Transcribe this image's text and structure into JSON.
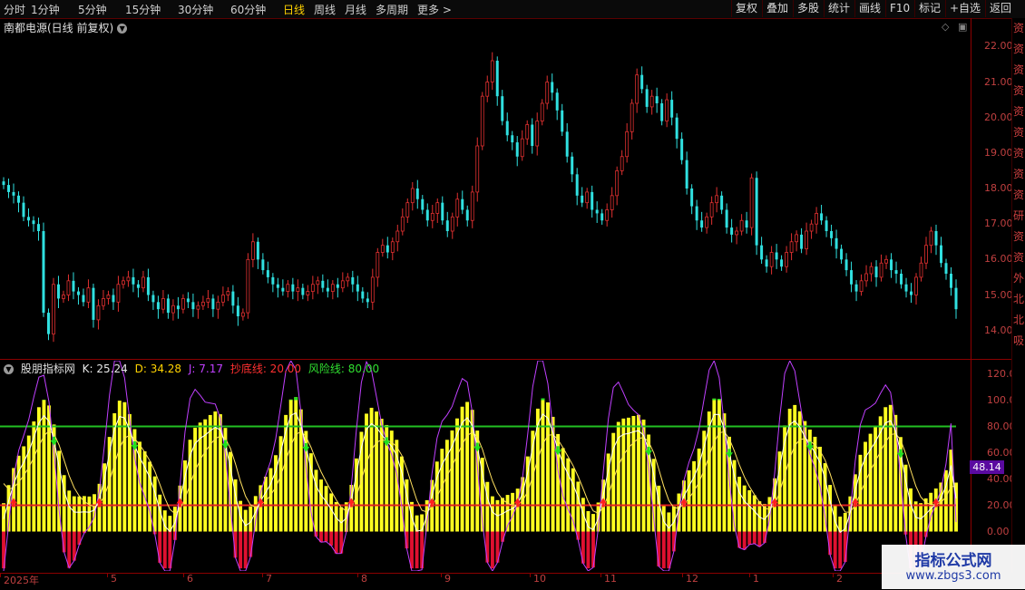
{
  "toolbar": {
    "timeframes": [
      "分时",
      "1分钟",
      "5分钟",
      "15分钟",
      "30分钟",
      "60分钟",
      "日线",
      "周线",
      "月线",
      "多周期",
      "更多 >"
    ],
    "active_index": 6,
    "buttons": [
      "复权",
      "叠加",
      "多股",
      "统计",
      "画线",
      "F10",
      "标记",
      "+自选",
      "返回"
    ]
  },
  "main_chart": {
    "stock_title": "南都电源(日线 前复权)",
    "price_ticks": [
      "22.00",
      "21.00",
      "20.00",
      "19.00",
      "18.00",
      "17.00",
      "16.00",
      "15.00",
      "14.00"
    ]
  },
  "indicator": {
    "name": "股朋指标网",
    "k_label": "K: 25.24",
    "d_label": "D: 34.28",
    "j_label": "J: 7.17",
    "bottom_label": "抄底线: 20.00",
    "risk_label": "风险线: 80.00",
    "ticks": [
      "120.0",
      "100.0",
      "80.00",
      "60.00",
      "40.00",
      "20.00",
      "0.00"
    ],
    "current_value": "48.14"
  },
  "dates": [
    "2025年",
    "5",
    "6",
    "7",
    "8",
    "9",
    "10",
    "11",
    "12",
    "1",
    "2"
  ],
  "right_strip_text": "资资资资资资资资资研资资外北北吸",
  "watermark": {
    "title": "指标公式网",
    "url": "www.zbgs3.com"
  },
  "colors": {
    "up": "#e03030",
    "down": "#30e0e0",
    "risk_line": "#22c022",
    "bottom_line": "#e02020",
    "bars": "#ffff20",
    "axis": "#8b0000",
    "active": "#ffd200"
  },
  "chart_data": [
    {
      "type": "candlestick",
      "title": "南都电源(日线 前复权)",
      "ylim": [
        13.2,
        22.8
      ],
      "close": [
        18.1,
        17.9,
        17.8,
        17.6,
        17.2,
        17.1,
        17.0,
        16.8,
        14.5,
        13.9,
        15.3,
        14.9,
        15.0,
        15.4,
        15.1,
        15.0,
        14.8,
        15.2,
        14.3,
        14.7,
        14.9,
        15.0,
        14.8,
        15.3,
        15.4,
        15.5,
        15.3,
        15.2,
        15.5,
        15.0,
        14.8,
        14.6,
        14.9,
        14.5,
        14.7,
        14.6,
        14.9,
        14.8,
        14.6,
        14.7,
        14.8,
        14.9,
        14.6,
        14.8,
        15.0,
        15.1,
        14.7,
        14.4,
        14.5,
        16.0,
        16.5,
        16.0,
        15.7,
        15.5,
        15.3,
        15.2,
        15.1,
        15.3,
        15.1,
        15.2,
        15.0,
        15.1,
        15.3,
        15.4,
        15.2,
        15.1,
        15.3,
        15.2,
        15.4,
        15.5,
        15.3,
        15.1,
        14.9,
        14.8,
        15.5,
        16.2,
        16.4,
        16.2,
        16.5,
        16.8,
        17.2,
        17.6,
        18.0,
        17.7,
        17.4,
        17.1,
        17.3,
        17.6,
        17.1,
        16.8,
        17.2,
        17.7,
        17.4,
        17.1,
        17.9,
        19.2,
        20.6,
        21.0,
        21.6,
        20.6,
        19.9,
        19.5,
        19.3,
        18.9,
        19.4,
        19.8,
        19.2,
        19.9,
        20.4,
        21.0,
        20.7,
        20.2,
        19.6,
        18.9,
        18.4,
        17.8,
        17.6,
        17.9,
        17.4,
        17.3,
        17.1,
        17.4,
        17.8,
        18.5,
        18.9,
        19.6,
        20.4,
        21.2,
        20.8,
        20.3,
        20.6,
        20.4,
        19.9,
        20.5,
        20.0,
        19.4,
        18.8,
        18.0,
        17.5,
        17.1,
        16.9,
        17.2,
        17.6,
        17.8,
        17.4,
        16.9,
        16.7,
        16.8,
        17.1,
        16.9,
        18.3,
        16.4,
        16.0,
        15.8,
        16.2,
        16.0,
        15.8,
        16.2,
        16.5,
        16.7,
        16.3,
        16.8,
        17.0,
        17.3,
        17.1,
        16.8,
        16.6,
        16.3,
        16.0,
        15.7,
        15.3,
        15.1,
        15.4,
        15.6,
        15.8,
        15.5,
        15.9,
        16.0,
        15.7,
        15.6,
        15.3,
        15.1,
        15.0,
        15.5,
        15.9,
        16.4,
        16.8,
        16.4,
        15.9,
        15.6,
        15.2,
        14.6
      ]
    },
    {
      "type": "line",
      "title": "股朋指标网",
      "ylim": [
        -30,
        130
      ],
      "series": [
        {
          "name": "K"
        },
        {
          "name": "D"
        },
        {
          "name": "J"
        }
      ],
      "reference_lines": [
        {
          "name": "抄底线",
          "value": 20
        },
        {
          "name": "风险线",
          "value": 80
        }
      ],
      "last": {
        "K": 25.24,
        "D": 34.28,
        "J": 7.17
      }
    }
  ]
}
